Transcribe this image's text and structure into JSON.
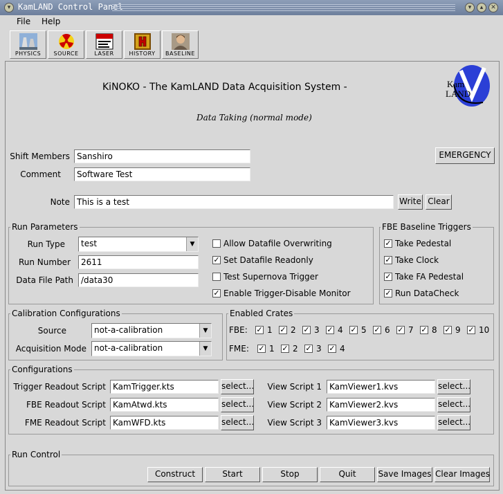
{
  "window": {
    "title": "KamLAND Control Panel"
  },
  "menu": {
    "file": "File",
    "help": "Help"
  },
  "toolbar": [
    {
      "label": "PHYSICS",
      "icon": "physics-icon"
    },
    {
      "label": "SOURCE",
      "icon": "radiation-icon"
    },
    {
      "label": "LASER",
      "icon": "laser-warning-icon"
    },
    {
      "label": "HISTORY",
      "icon": "history-icon"
    },
    {
      "label": "BASELINE",
      "icon": "person-icon"
    }
  ],
  "header": {
    "title": "KiNOKO - The KamLAND Data Acquisition System -",
    "mode": "Data Taking (normal mode)",
    "logo_text_1": "Kam",
    "logo_text_2": "LAND"
  },
  "shift": {
    "shift_label": "Shift Members",
    "shift_value": "Sanshiro",
    "comment_label": "Comment",
    "comment_value": "Software Test",
    "note_label": "Note",
    "note_value": "This is a test",
    "write": "Write",
    "clear": "Clear",
    "emergency": "EMERGENCY"
  },
  "run_params": {
    "title": "Run Parameters",
    "run_type_label": "Run Type",
    "run_type": "test",
    "run_number_label": "Run Number",
    "run_number": "2611",
    "data_path_label": "Data File Path",
    "data_path": "/data30",
    "options": [
      {
        "label": "Allow Datafile Overwriting",
        "checked": false
      },
      {
        "label": "Set Datafile Readonly",
        "checked": true
      },
      {
        "label": "Test Supernova Trigger",
        "checked": false
      },
      {
        "label": "Enable Trigger-Disable Monitor",
        "checked": true
      }
    ]
  },
  "fbe": {
    "title": "FBE Baseline Triggers",
    "options": [
      {
        "label": "Take Pedestal",
        "checked": true
      },
      {
        "label": "Take Clock",
        "checked": true
      },
      {
        "label": "Take FA Pedestal",
        "checked": true
      },
      {
        "label": "Run DataCheck",
        "checked": true
      }
    ]
  },
  "calib": {
    "title": "Calibration Configurations",
    "source_label": "Source",
    "source": "not-a-calibration",
    "mode_label": "Acquisition Mode",
    "mode": "not-a-calibration"
  },
  "crates": {
    "title": "Enabled Crates",
    "fbe_label": "FBE:",
    "fbe": [
      "1",
      "2",
      "3",
      "4",
      "5",
      "6",
      "7",
      "8",
      "9",
      "10"
    ],
    "fme_label": "FME:",
    "fme": [
      "1",
      "2",
      "3",
      "4"
    ]
  },
  "configs": {
    "title": "Configurations",
    "select": "select...",
    "left": [
      {
        "label": "Trigger Readout Script",
        "value": "KamTrigger.kts"
      },
      {
        "label": "FBE Readout Script",
        "value": "KamAtwd.kts"
      },
      {
        "label": "FME Readout Script",
        "value": "KamWFD.kts"
      }
    ],
    "right": [
      {
        "label": "View Script 1",
        "value": "KamViewer1.kvs"
      },
      {
        "label": "View Script 2",
        "value": "KamViewer2.kvs"
      },
      {
        "label": "View Script 3",
        "value": "KamViewer3.kvs"
      }
    ]
  },
  "run_control": {
    "title": "Run Control",
    "construct": "Construct",
    "start": "Start",
    "stop": "Stop",
    "quit": "Quit",
    "save_images": "Save Images",
    "clear_images": "Clear Images"
  }
}
